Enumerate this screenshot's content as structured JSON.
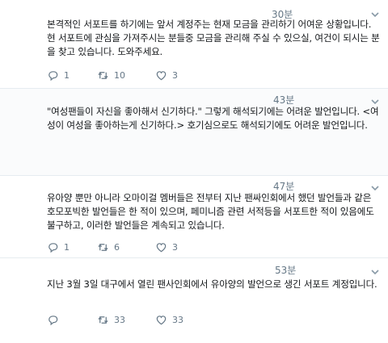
{
  "tweets": [
    {
      "time": "30분",
      "text": "본격적인 서포트를 하기에는 앞서 계정주는 현재 모금을 관리하기 어여운 상황입니다. 현 서포트에 관심을 가져주시는 분들중 모금을 관리해 주실 수 있으실, 여건이 되시는 분을 찾고 있습니다. 도와주세요.",
      "replies": "1",
      "retweets": "10",
      "likes": "3"
    },
    {
      "time": "43분",
      "text": "\"여성팬들이 자신을 좋아해서 신기하다.\" 그렇게 해석되기에는 어려운 발언입니다. <여성이 여성을 좋아하는게 신기하다.> 호기심으로도 해석되기에도 어려운 발언입니다.",
      "replies": "",
      "retweets": "",
      "likes": ""
    },
    {
      "time": "47분",
      "text": "유아양 뿐만 아니라 오마이걸 멤버들은 전부터 지난 팬싸인회에서 했던 발언들과 같은 호모포빅한 발언들은 한 적이 있으며, 페미니즘 관련 서적등을 서포트한 적이 있음에도 불구하고, 이러한 발언들은 계속되고 있습니다.",
      "replies": "1",
      "retweets": "6",
      "likes": "3"
    },
    {
      "time": "53분",
      "text": "지난 3월 3일 대구에서 열린 팬사인회에서 유아양의 발언으로 생긴 서포트 계정입니다.",
      "replies": "",
      "retweets": "33",
      "likes": "33"
    }
  ],
  "icons": {
    "reply": "reply-icon",
    "retweet": "retweet-icon",
    "like": "like-icon",
    "caret": "chevron-down-icon"
  },
  "colors": {
    "text": "#14171a",
    "muted": "#657786",
    "divider": "#e6ecf0"
  }
}
